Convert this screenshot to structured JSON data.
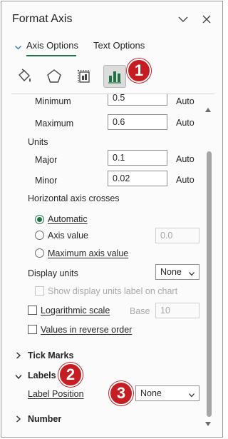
{
  "header": {
    "title": "Format Axis"
  },
  "tabs": [
    {
      "label": "Axis Options"
    },
    {
      "label": "Text Options"
    }
  ],
  "icons": [
    "fill-line-icon",
    "effects-icon",
    "size-properties-icon",
    "axis-options-icon"
  ],
  "badges": {
    "one": "1",
    "two": "2",
    "three": "3"
  },
  "bounds": {
    "minimum_label": "Minimum",
    "minimum_value": "0.5",
    "minimum_auto": "Auto",
    "maximum_label": "Maximum",
    "maximum_value": "0.6",
    "maximum_auto": "Auto"
  },
  "units": {
    "heading": "Units",
    "major_label": "Major",
    "major_value": "0.1",
    "major_auto": "Auto",
    "minor_label": "Minor",
    "minor_value": "0.02",
    "minor_auto": "Auto"
  },
  "crosses": {
    "heading": "Horizontal axis crosses",
    "automatic": "Automatic",
    "axis_value": "Axis value",
    "axis_value_input": "0.0",
    "max_axis_value": "Maximum axis value"
  },
  "display_units": {
    "label": "Display units",
    "selected": "None",
    "show_label": "Show display units label on chart"
  },
  "log_scale": {
    "label": "Logarithmic scale",
    "base_label": "Base",
    "base_value": "10"
  },
  "reverse_order": {
    "label": "Values in reverse order"
  },
  "sections": {
    "tick_marks": "Tick Marks",
    "labels": "Labels",
    "number": "Number"
  },
  "label_position": {
    "label": "Label Position",
    "selected": "None"
  },
  "colors": {
    "accent": "#217346",
    "badge": "#c61d23"
  }
}
